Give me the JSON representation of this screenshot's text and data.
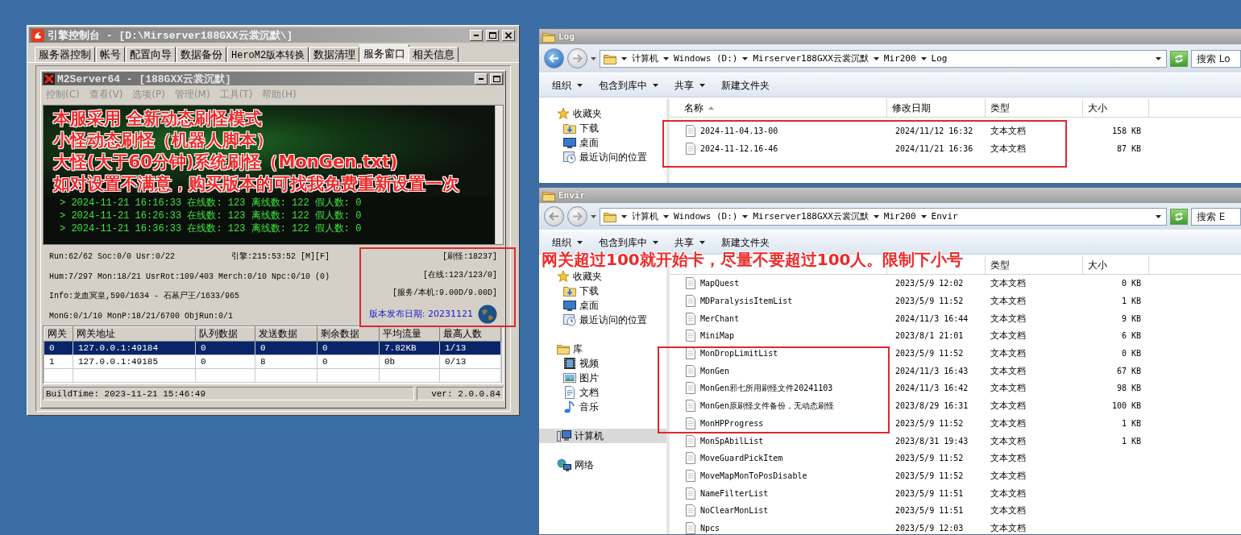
{
  "engine_window": {
    "title": "引擎控制台 - [D:\\Mirserver188GXX云裳沉默\\]",
    "tabs": [
      {
        "label": "服务器控制",
        "selected": false
      },
      {
        "label": "帐号",
        "selected": false
      },
      {
        "label": "配置向导",
        "selected": false
      },
      {
        "label": "数据备份",
        "selected": false
      },
      {
        "label": "HeroM2版本转换",
        "selected": false
      },
      {
        "label": "数据清理",
        "selected": false
      },
      {
        "label": "服务窗口",
        "selected": true
      },
      {
        "label": "相关信息",
        "selected": false
      }
    ],
    "server_window": {
      "title": "M2Server64 - [188GXX云裳沉默]",
      "menu": [
        {
          "label": "控制(C)",
          "disabled": true
        },
        {
          "label": "查看(V)",
          "disabled": true
        },
        {
          "label": "选项(P)",
          "disabled": true
        },
        {
          "label": "管理(M)",
          "disabled": true
        },
        {
          "label": "工具(T)",
          "disabled": true
        },
        {
          "label": "帮助(H)",
          "disabled": true
        }
      ],
      "overlay_text": [
        "本服采用 全新动态刷怪模式",
        "小怪动态刷怪（机器人脚本）",
        "大怪(大于60分钟)系统刷怪（MonGen.txt)",
        "如对设置不满意，购买版本的可找我免费重新设置一次"
      ],
      "log_lines": [
        "> 2024-11-21 16:16:33 在线数: 123 离线数: 122 假人数: 0",
        "> 2024-11-21 16:26:33 在线数: 123 离线数: 122 假人数: 0",
        "> 2024-11-21 16:36:33 在线数: 123 离线数: 122 假人数: 0"
      ],
      "status": {
        "run": "Run:62/62 Soc:0/0 Usr:0/22",
        "uptime": "引擎:215:53:52 [M][F]",
        "lines": [
          "Hum:7/297 Mon:18/21 UsrRot:109/403 Merch:0/10 Npc:0/10 (0)",
          "Info:龙血冥皇,590/1634 - 石墓尸王/1633/965",
          "MonG:0/1/10 MonP:18/21/6700 ObjRun:0/1"
        ],
        "counters": [
          "[刷怪:18237]",
          "[在线:123/123/0]",
          "[服务/本机:9.00D/9.00D]"
        ],
        "release_date": "版本发布日期: 20231121"
      },
      "gateways": {
        "columns": [
          "网关",
          "网关地址",
          "队列数据",
          "发送数据",
          "剩余数据",
          "平均流量",
          "最高人数"
        ],
        "rows": [
          {
            "cells": [
              "0",
              "127.0.0.1:49184",
              "0",
              "0",
              "0",
              "7.82KB",
              "1/13"
            ],
            "selected": true
          },
          {
            "cells": [
              "1",
              "127.0.0.1:49185",
              "0",
              "8",
              "0",
              "0b",
              "0/13"
            ],
            "selected": false
          }
        ]
      },
      "status_bar": {
        "build_time": "BuildTime: 2023-11-21 15:46:49",
        "version": "ver: 2.0.0.84"
      }
    }
  },
  "log_window": {
    "title": "Log",
    "back_enabled": true,
    "breadcrumb": [
      "计算机",
      "Windows (D:)",
      "Mirserver188GXX云裳沉默",
      "Mir200",
      "Log"
    ],
    "search": {
      "placeholder": "搜索 Lo"
    },
    "toolbar": [
      {
        "label": "组织",
        "menu": true
      },
      {
        "label": "包含到库中",
        "menu": true
      },
      {
        "label": "共享",
        "menu": true
      },
      {
        "label": "新建文件夹",
        "menu": false
      }
    ],
    "sidebar": [
      {
        "label": "收藏夹",
        "selected": false,
        "children": [
          {
            "label": "下载",
            "selected": false
          },
          {
            "label": "桌面",
            "selected": false
          },
          {
            "label": "最近访问的位置",
            "selected": false
          }
        ]
      }
    ],
    "columns": [
      "名称",
      "修改日期",
      "类型",
      "大小"
    ],
    "files": [
      {
        "name": "2024-11-04.13-00",
        "modified": "2024/11/12 16:32",
        "type": "文本文档",
        "size": "158 KB"
      },
      {
        "name": "2024-11-12.16-46",
        "modified": "2024/11/21 16:36",
        "type": "文本文档",
        "size": "87 KB"
      }
    ]
  },
  "envir_window": {
    "title": "Envir",
    "back_enabled": false,
    "breadcrumb": [
      "计算机",
      "Windows (D:)",
      "Mirserver188GXX云裳沉默",
      "Mir200",
      "Envir"
    ],
    "search": {
      "placeholder": "搜索 E"
    },
    "toolbar": [
      {
        "label": "组织",
        "menu": true
      },
      {
        "label": "包含到库中",
        "menu": true
      },
      {
        "label": "共享",
        "menu": true
      },
      {
        "label": "新建文件夹",
        "menu": false
      }
    ],
    "sidebar": [
      {
        "label": "收藏夹",
        "selected": false,
        "children": [
          {
            "label": "下载",
            "selected": false
          },
          {
            "label": "桌面",
            "selected": false
          },
          {
            "label": "最近访问的位置",
            "selected": false
          }
        ]
      },
      {
        "label": "库",
        "selected": false,
        "children": [
          {
            "label": "视频",
            "selected": false
          },
          {
            "label": "图片",
            "selected": false
          },
          {
            "label": "文档",
            "selected": false
          },
          {
            "label": "音乐",
            "selected": false
          }
        ]
      },
      {
        "label": "计算机",
        "selected": true
      },
      {
        "label": "网络",
        "selected": false
      }
    ],
    "columns": [
      "类型",
      "大小"
    ],
    "files": [
      {
        "name": "MapQuest",
        "modified": "2023/5/9 12:02",
        "type": "文本文档",
        "size": "0 KB"
      },
      {
        "name": "MDParalysisItemList",
        "modified": "2023/5/9 11:52",
        "type": "文本文档",
        "size": "1 KB"
      },
      {
        "name": "MerChant",
        "modified": "2024/11/3 16:44",
        "type": "文本文档",
        "size": "9 KB"
      },
      {
        "name": "MiniMap",
        "modified": "2023/8/1 21:01",
        "type": "文本文档",
        "size": "6 KB"
      },
      {
        "name": "MonDropLimitList",
        "modified": "2023/5/9 11:52",
        "type": "文本文档",
        "size": "0 KB"
      },
      {
        "name": "MonGen",
        "modified": "2024/11/3 16:43",
        "type": "文本文档",
        "size": "67 KB"
      },
      {
        "name": "MonGen邪七所用刷怪文件20241103",
        "modified": "2024/11/3 16:42",
        "type": "文本文档",
        "size": "98 KB"
      },
      {
        "name": "MonGen原刷怪文件备份，无动态刷怪",
        "modified": "2023/8/29 16:31",
        "type": "文本文档",
        "size": "100 KB"
      },
      {
        "name": "MonHPProgress",
        "modified": "2023/5/9 11:52",
        "type": "文本文档",
        "size": "1 KB"
      },
      {
        "name": "MonSpAbilList",
        "modified": "2023/8/31 19:43",
        "type": "文本文档",
        "size": "1 KB"
      },
      {
        "name": "MoveGuardPickItem",
        "modified": "2023/5/9 11:52",
        "type": "文本文档"
      },
      {
        "name": "MoveMapMonToPosDisable",
        "modified": "2023/5/9 11:52",
        "type": "文本文档"
      },
      {
        "name": "NameFilterList",
        "modified": "2023/5/9 11:51",
        "type": "文本文档"
      },
      {
        "name": "NoClearMonList",
        "modified": "2023/5/9 11:51",
        "type": "文本文档"
      },
      {
        "name": "Npcs",
        "modified": "2023/5/9 12:03",
        "type": "文本文档"
      }
    ]
  },
  "annotation": {
    "text": "网关超过100就开始卡，尽量不要超过100人。限制下小号"
  }
}
